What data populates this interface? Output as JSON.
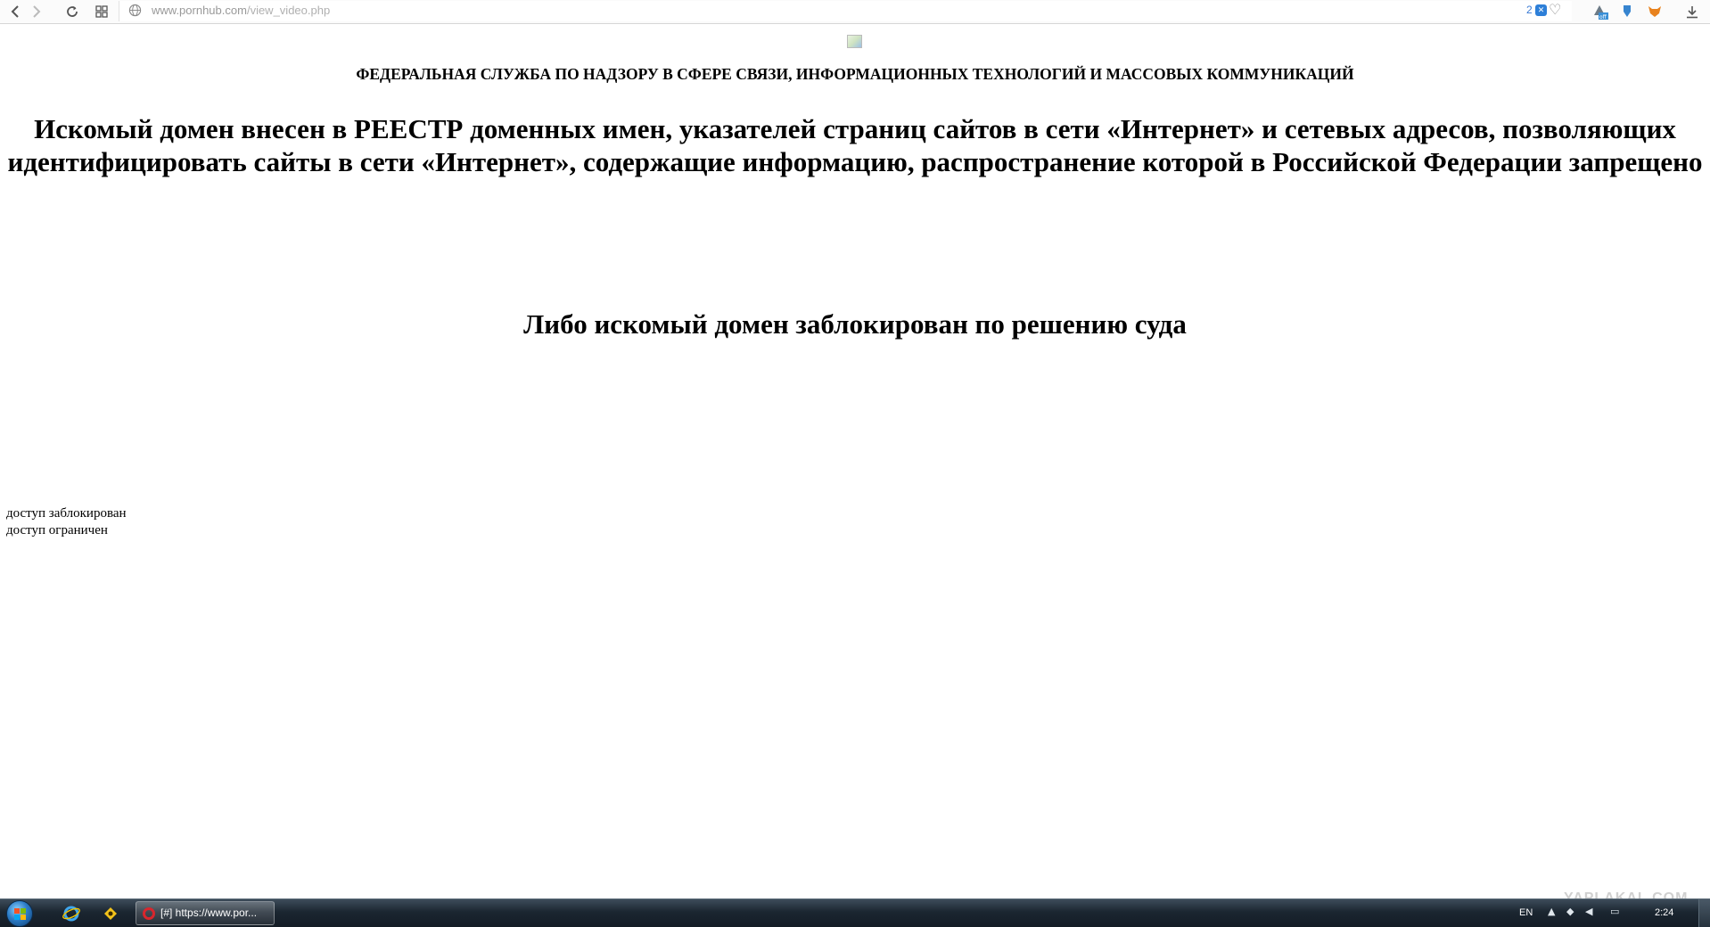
{
  "browser": {
    "url_host": "www.pornhub.com",
    "url_path": "/view_video.php",
    "badge_count": "2",
    "ext_off_label": "off"
  },
  "page": {
    "agency": "ФЕДЕРАЛЬНАЯ СЛУЖБА ПО НАДЗОРУ В СФЕРЕ СВЯЗИ, ИНФОРМАЦИОННЫХ ТЕХНОЛОГИЙ И МАССОВЫХ КОММУНИКАЦИЙ",
    "headline": "Искомый домен внесен в РЕЕСТР доменных имен, указателей страниц сайтов в сети «Интернет» и сетевых адресов, позволяющих идентифицировать сайты в сети «Интернет», содержащие информацию, распространение которой в Российской Федерации запрещено",
    "headline2": "Либо искомый домен заблокирован по решению суда",
    "line1": "доступ заблокирован",
    "line2": "доступ ограничен"
  },
  "watermark": "YAPLAKAL.COM",
  "taskbar": {
    "task_label": "[#] https://www.por...",
    "language": "EN",
    "clock": "2:24"
  },
  "icons": {
    "back": "back-arrow-icon",
    "forward": "forward-arrow-icon",
    "reload": "reload-icon",
    "speed_dial": "grid-icon",
    "site_info": "globe-icon",
    "bookmark": "heart-icon",
    "download": "download-icon"
  },
  "colors": {
    "url_text": "#999999",
    "badge_blue": "#2d7fd8",
    "taskbar_bg": "#1b2631",
    "opera_red": "#d8262d"
  }
}
